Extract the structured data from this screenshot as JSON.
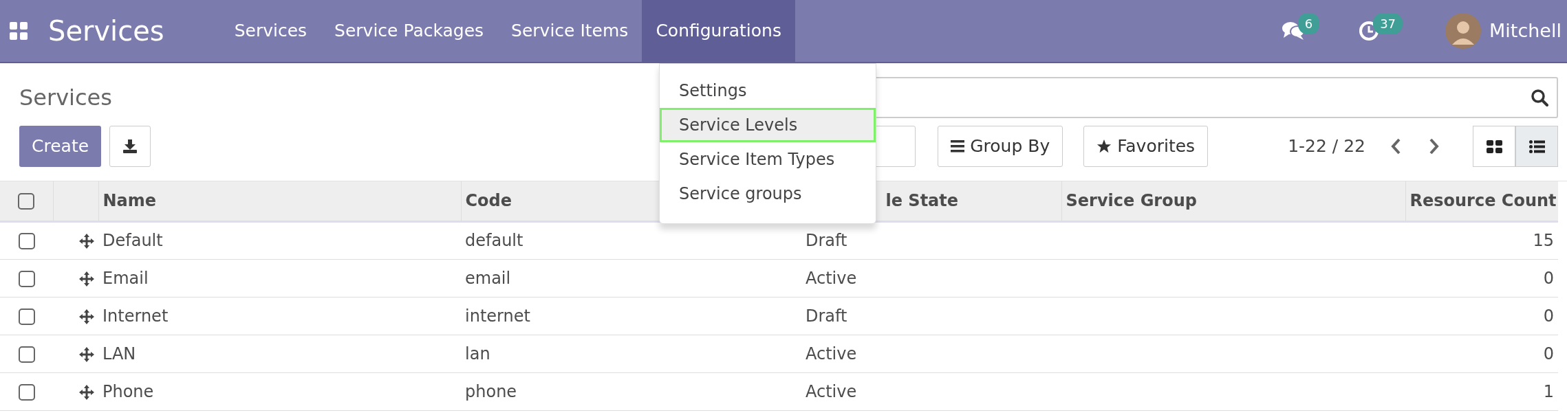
{
  "navbar": {
    "app_title": "Services",
    "menu": [
      {
        "label": "Services",
        "selected": false
      },
      {
        "label": "Service Packages",
        "selected": false
      },
      {
        "label": "Service Items",
        "selected": false
      },
      {
        "label": "Configurations",
        "selected": true
      }
    ],
    "messages_count": "6",
    "activities_count": "37",
    "user": "Mitchell"
  },
  "dropdown": {
    "items": [
      {
        "label": "Settings",
        "selected": false
      },
      {
        "label": "Service Levels",
        "selected": true
      },
      {
        "label": "Service Item Types",
        "selected": false
      },
      {
        "label": "Service groups",
        "selected": false
      }
    ]
  },
  "breadcrumb": "Services",
  "create_button": "Create",
  "group_by": "Group By",
  "favorites": "Favorites",
  "pager": "1-22 / 22",
  "views": [
    {
      "kind": "kanban",
      "selected": false
    },
    {
      "kind": "list",
      "selected": true
    }
  ],
  "table": {
    "header_checked": false,
    "columns": [
      "Name",
      "Code",
      "le State",
      "Service Group",
      "Resource Count"
    ],
    "rows": [
      {
        "checked": false,
        "name": "Default",
        "code": "default",
        "state": "Draft",
        "resource_count": "15"
      },
      {
        "checked": false,
        "name": "Email",
        "code": "email",
        "state": "Active",
        "resource_count": "0"
      },
      {
        "checked": false,
        "name": "Internet",
        "code": "internet",
        "state": "Draft",
        "resource_count": "0"
      },
      {
        "checked": false,
        "name": "LAN",
        "code": "lan",
        "state": "Active",
        "resource_count": "0"
      },
      {
        "checked": false,
        "name": "Phone",
        "code": "phone",
        "state": "Active",
        "resource_count": "1"
      }
    ]
  }
}
